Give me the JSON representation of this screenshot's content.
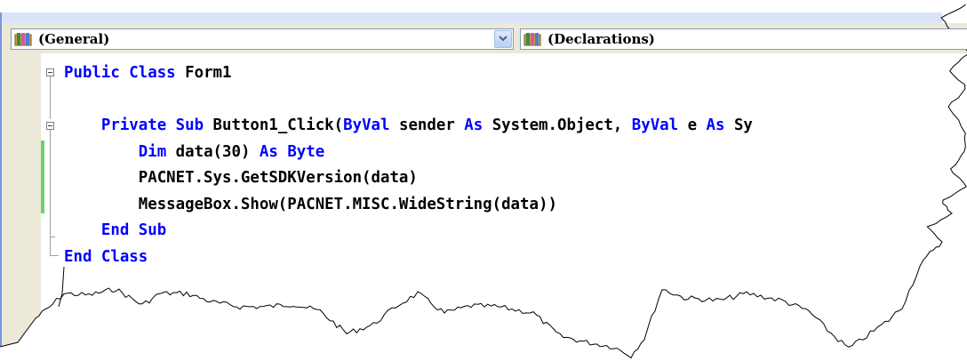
{
  "combos": {
    "object": {
      "value": "(General)",
      "icon": "class-icon"
    },
    "member": {
      "value": "(Declarations)",
      "icon": "class-icon"
    }
  },
  "code": {
    "lines": [
      [
        {
          "t": "Public ",
          "k": 1
        },
        {
          "t": "Class ",
          "k": 1
        },
        {
          "t": "Form1",
          "k": 0
        }
      ],
      [],
      [
        {
          "t": "    ",
          "k": 0
        },
        {
          "t": "Private ",
          "k": 1
        },
        {
          "t": "Sub ",
          "k": 1
        },
        {
          "t": "Button1_Click(",
          "k": 0
        },
        {
          "t": "ByVal",
          "k": 1
        },
        {
          "t": " sender ",
          "k": 0
        },
        {
          "t": "As",
          "k": 1
        },
        {
          "t": " System.Object, ",
          "k": 0
        },
        {
          "t": "ByVal",
          "k": 1
        },
        {
          "t": " e ",
          "k": 0
        },
        {
          "t": "As",
          "k": 1
        },
        {
          "t": " Sy",
          "k": 0
        }
      ],
      [
        {
          "t": "        ",
          "k": 0
        },
        {
          "t": "Dim",
          "k": 1
        },
        {
          "t": " data(30) ",
          "k": 0
        },
        {
          "t": "As ",
          "k": 1
        },
        {
          "t": "Byte",
          "k": 1
        }
      ],
      [
        {
          "t": "        PACNET.Sys.GetSDKVersion(data)",
          "k": 0
        }
      ],
      [
        {
          "t": "        MessageBox.Show(PACNET.MISC.WideString(data))",
          "k": 0
        }
      ],
      [
        {
          "t": "    ",
          "k": 0
        },
        {
          "t": "End ",
          "k": 1
        },
        {
          "t": "Sub",
          "k": 1
        }
      ],
      [
        {
          "t": "End ",
          "k": 1
        },
        {
          "t": "Class",
          "k": 1
        }
      ]
    ]
  },
  "colors": {
    "keyword": "#0000ff",
    "text": "#000000",
    "gutter": "#ece9d8",
    "changed_marker": "#6dd16d",
    "combo_border": "#7f9db9"
  }
}
